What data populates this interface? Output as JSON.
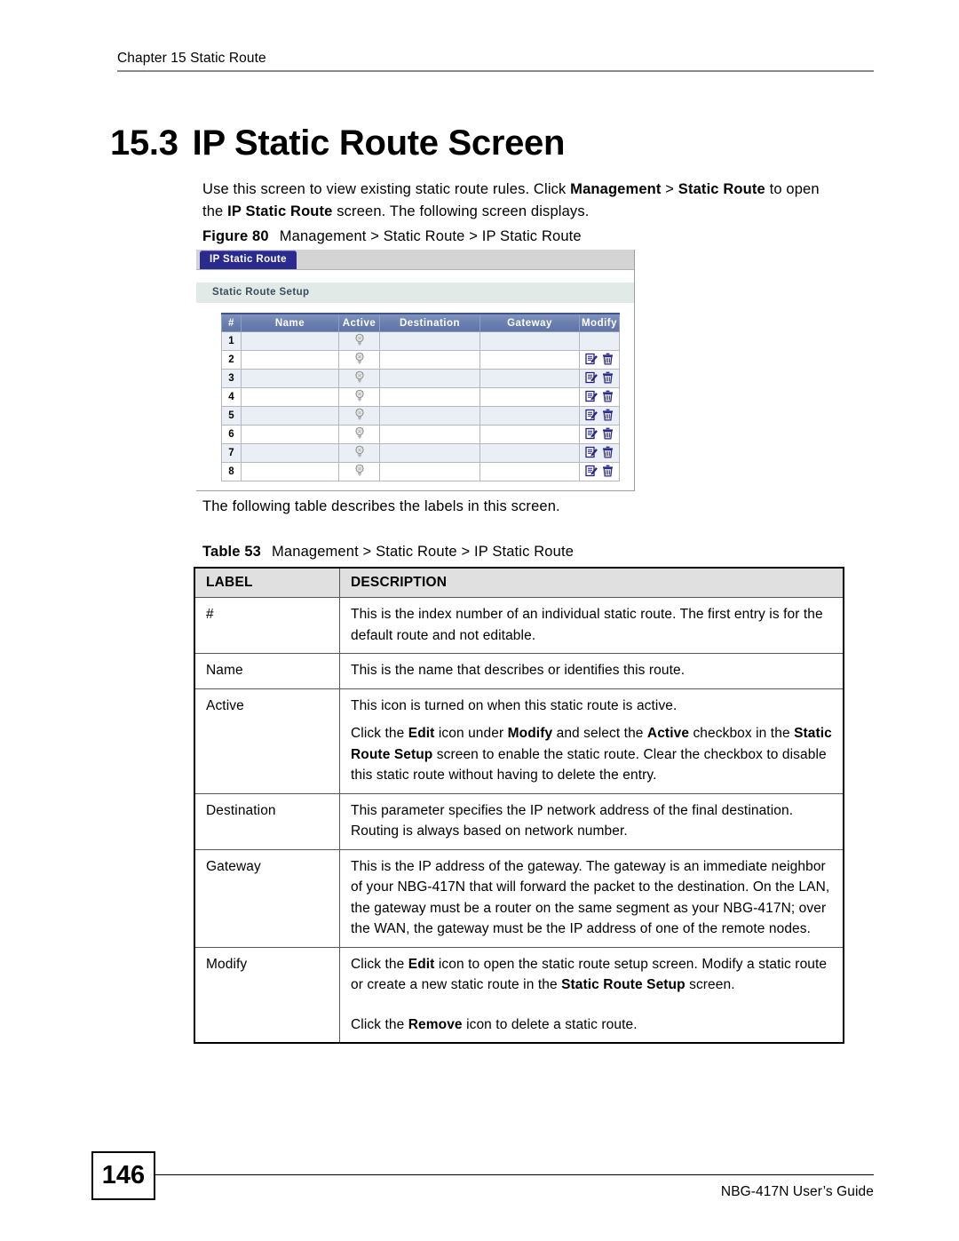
{
  "page": {
    "running_header": "Chapter 15 Static Route",
    "page_number": "146",
    "footer_guide": "NBG-417N User’s Guide"
  },
  "section": {
    "number": "15.3",
    "title": "IP Static Route Screen"
  },
  "intro": {
    "part1": "Use this screen to view existing static route rules. Click ",
    "bold1": "Management",
    "part2": " > ",
    "bold2": "Static Route",
    "part3": " to open the ",
    "bold3": "IP Static Route",
    "part4": " screen. The following screen displays."
  },
  "figure": {
    "label": "Figure 80",
    "title": "Management > Static Route > IP Static Route"
  },
  "screenshot": {
    "tab_label": "IP Static Route",
    "section_title": "Static Route Setup",
    "table": {
      "headers": [
        "#",
        "Name",
        "Active",
        "Destination",
        "Gateway",
        "Modify"
      ],
      "rows": [
        {
          "index": "1",
          "name": "",
          "active": "inactive",
          "destination": "",
          "gateway": "",
          "modify": false
        },
        {
          "index": "2",
          "name": "",
          "active": "inactive",
          "destination": "",
          "gateway": "",
          "modify": true
        },
        {
          "index": "3",
          "name": "",
          "active": "inactive",
          "destination": "",
          "gateway": "",
          "modify": true
        },
        {
          "index": "4",
          "name": "",
          "active": "inactive",
          "destination": "",
          "gateway": "",
          "modify": true
        },
        {
          "index": "5",
          "name": "",
          "active": "inactive",
          "destination": "",
          "gateway": "",
          "modify": true
        },
        {
          "index": "6",
          "name": "",
          "active": "inactive",
          "destination": "",
          "gateway": "",
          "modify": true
        },
        {
          "index": "7",
          "name": "",
          "active": "inactive",
          "destination": "",
          "gateway": "",
          "modify": true
        },
        {
          "index": "8",
          "name": "",
          "active": "inactive",
          "destination": "",
          "gateway": "",
          "modify": true
        }
      ],
      "icons": {
        "active": "lightbulb-icon",
        "edit": "edit-icon",
        "remove": "trash-icon"
      }
    },
    "colors": {
      "tab_background": "#2b2b8f",
      "tab_text": "#ffffff",
      "tabbar_background": "#d4d4d4",
      "section_bar_background": "#e2eae8",
      "table_header_background": "#6c81b0",
      "row_odd_background": "#e9eff5",
      "row_even_background": "#ffffff"
    }
  },
  "describe_line": "The following table describes the labels in this screen.",
  "table53": {
    "label": "Table 53",
    "title": "Management > Static Route > IP Static Route",
    "headers": {
      "label": "LABEL",
      "description": "DESCRIPTION"
    },
    "rows": [
      {
        "label": "#",
        "description": "This is the index number of an individual static route. The first entry is for the default route and not editable."
      },
      {
        "label": "Name",
        "description": "This is the name that describes or identifies this route."
      },
      {
        "label": "Active",
        "description": "This icon is turned on when this static route is active."
      },
      {
        "label": "",
        "desc_parts": {
          "p1a": "Click the ",
          "p1b": "Edit",
          "p1c": " icon under ",
          "p1d": "Modify",
          "p1e": " and select the ",
          "p1f": "Active",
          "p1g": " checkbox in the ",
          "p1h": "Static Route Setup",
          "p1i": " screen to enable the static route. Clear the checkbox to disable this static route without having to delete the entry."
        }
      },
      {
        "label": "Destination",
        "description": "This parameter specifies the IP network address of the final destination. Routing is always based on network number."
      },
      {
        "label": "Gateway",
        "description": "This is the IP address of the gateway. The gateway is an immediate neighbor of your NBG-417N that will forward the packet to the destination. On the LAN, the gateway must be a router on the same segment as your NBG-417N; over the WAN, the gateway must be the IP address of one of the remote nodes."
      },
      {
        "label": "Modify",
        "desc_parts": {
          "p1a": "Click the ",
          "p1b": "Edit",
          "p1c": " icon to open the static route setup screen. Modify a static route or create a new static route in the ",
          "p1d": "Static Route Setup",
          "p1e": " screen.",
          "p2a": "Click the ",
          "p2b": "Remove",
          "p2c": " icon to delete a static route."
        }
      }
    ]
  }
}
